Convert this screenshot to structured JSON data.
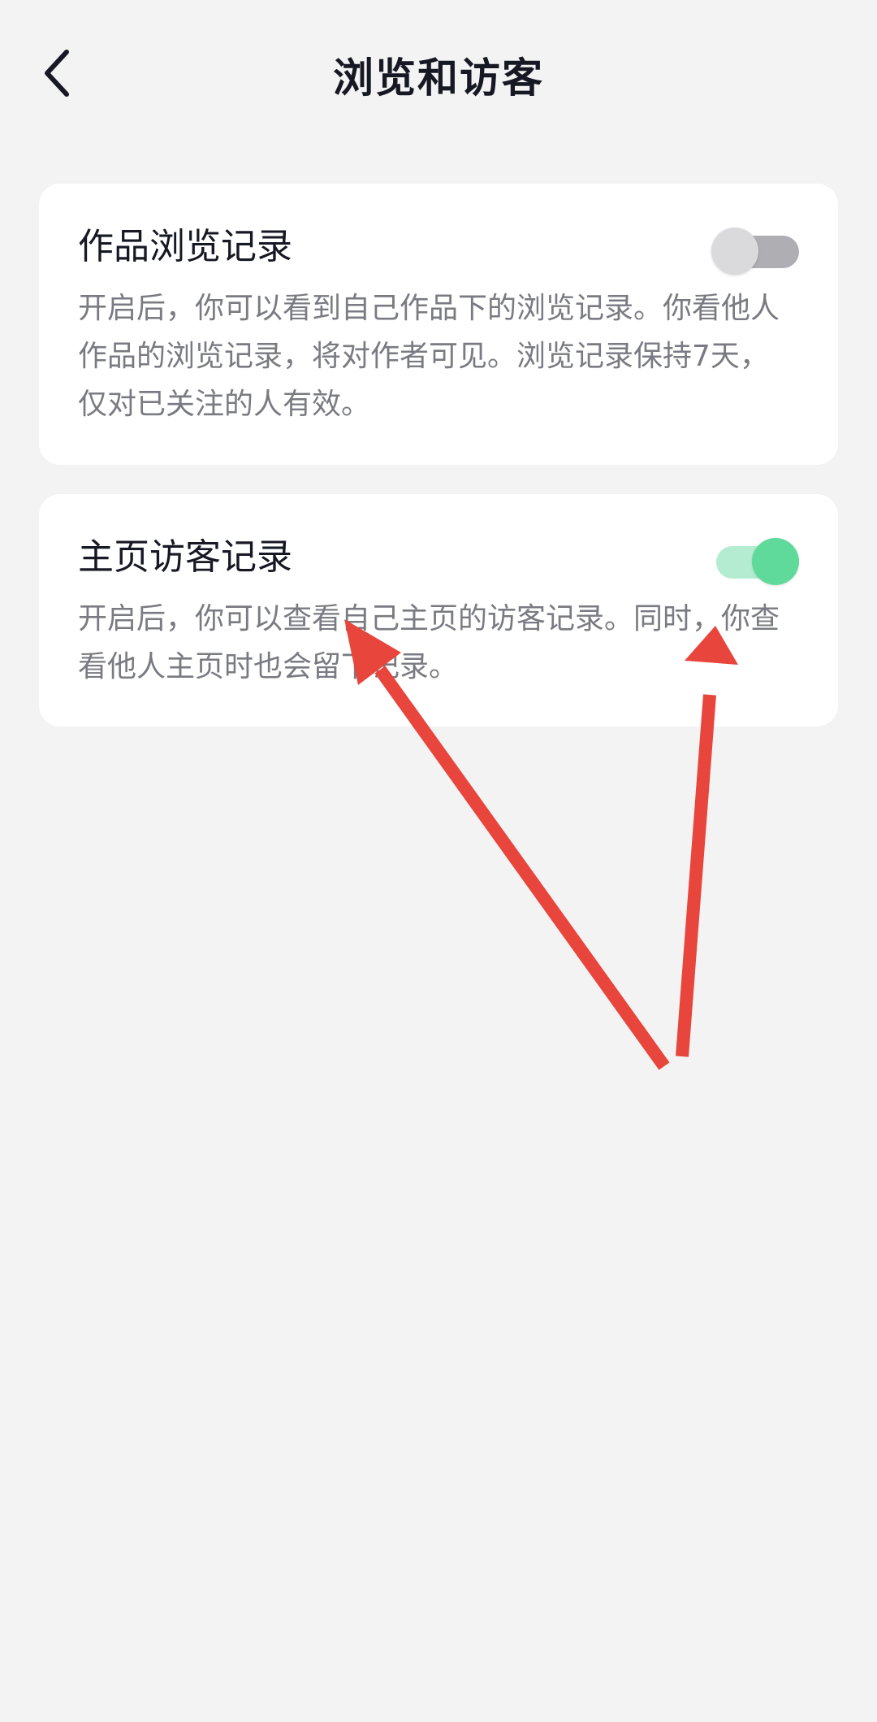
{
  "header": {
    "title": "浏览和访客",
    "back_icon": "chevron-left-icon"
  },
  "settings": [
    {
      "title": "作品浏览记录",
      "description": "开启后，你可以看到自己作品下的浏览记录。你看他人作品的浏览记录，将对作者可见。浏览记录保持7天，仅对已关注的人有效。",
      "enabled": false
    },
    {
      "title": "主页访客记录",
      "description": "开启后，你可以查看自己主页的访客记录。同时，你查看他人主页时也会留下记录。",
      "enabled": true
    }
  ],
  "colors": {
    "background": "#f3f3f3",
    "card": "#ffffff",
    "title_text": "#161823",
    "description_text": "#7a7b82",
    "toggle_on": "#60da9a",
    "toggle_on_track": "#b4ecd2",
    "toggle_off_knob": "#dadadd",
    "toggle_off_track": "#aeaeb3",
    "annotation_arrow": "#e8453c"
  }
}
